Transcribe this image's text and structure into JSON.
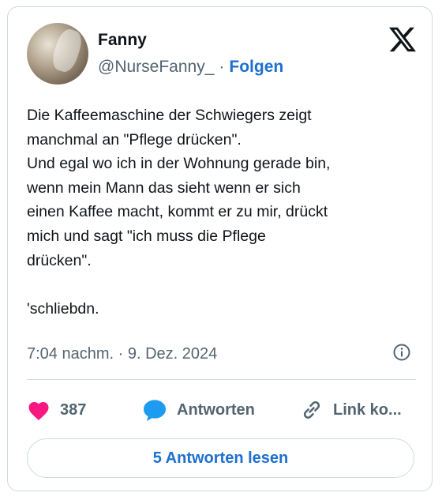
{
  "author": {
    "name": "Fanny",
    "handle": "@NurseFanny_",
    "separator": "·",
    "follow_label": "Folgen"
  },
  "tweet": {
    "text": "Die Kaffeemaschine der Schwiegers zeigt\nmanchmal an \"Pflege drücken\".\nUnd egal wo ich in der Wohnung gerade bin,\nwenn mein Mann das sieht wenn er sich\neinen Kaffee macht, kommt er zu mir, drückt\nmich und sagt \"ich muss die Pflege\ndrücken\".\n\n'schliebdn.",
    "timestamp": "7:04 nachm. · 9. Dez. 2024"
  },
  "actions": {
    "like_count": "387",
    "reply_label": "Antworten",
    "copy_label": "Link ko..."
  },
  "read_replies_label": "5 Antworten lesen",
  "icons": [
    "x-logo-icon",
    "info-icon",
    "heart-icon",
    "reply-bubble-icon",
    "link-icon"
  ],
  "colors": {
    "accent": "#1d6fd0",
    "heart": "#f91880",
    "reply": "#1d9bf0",
    "muted": "#536471"
  }
}
